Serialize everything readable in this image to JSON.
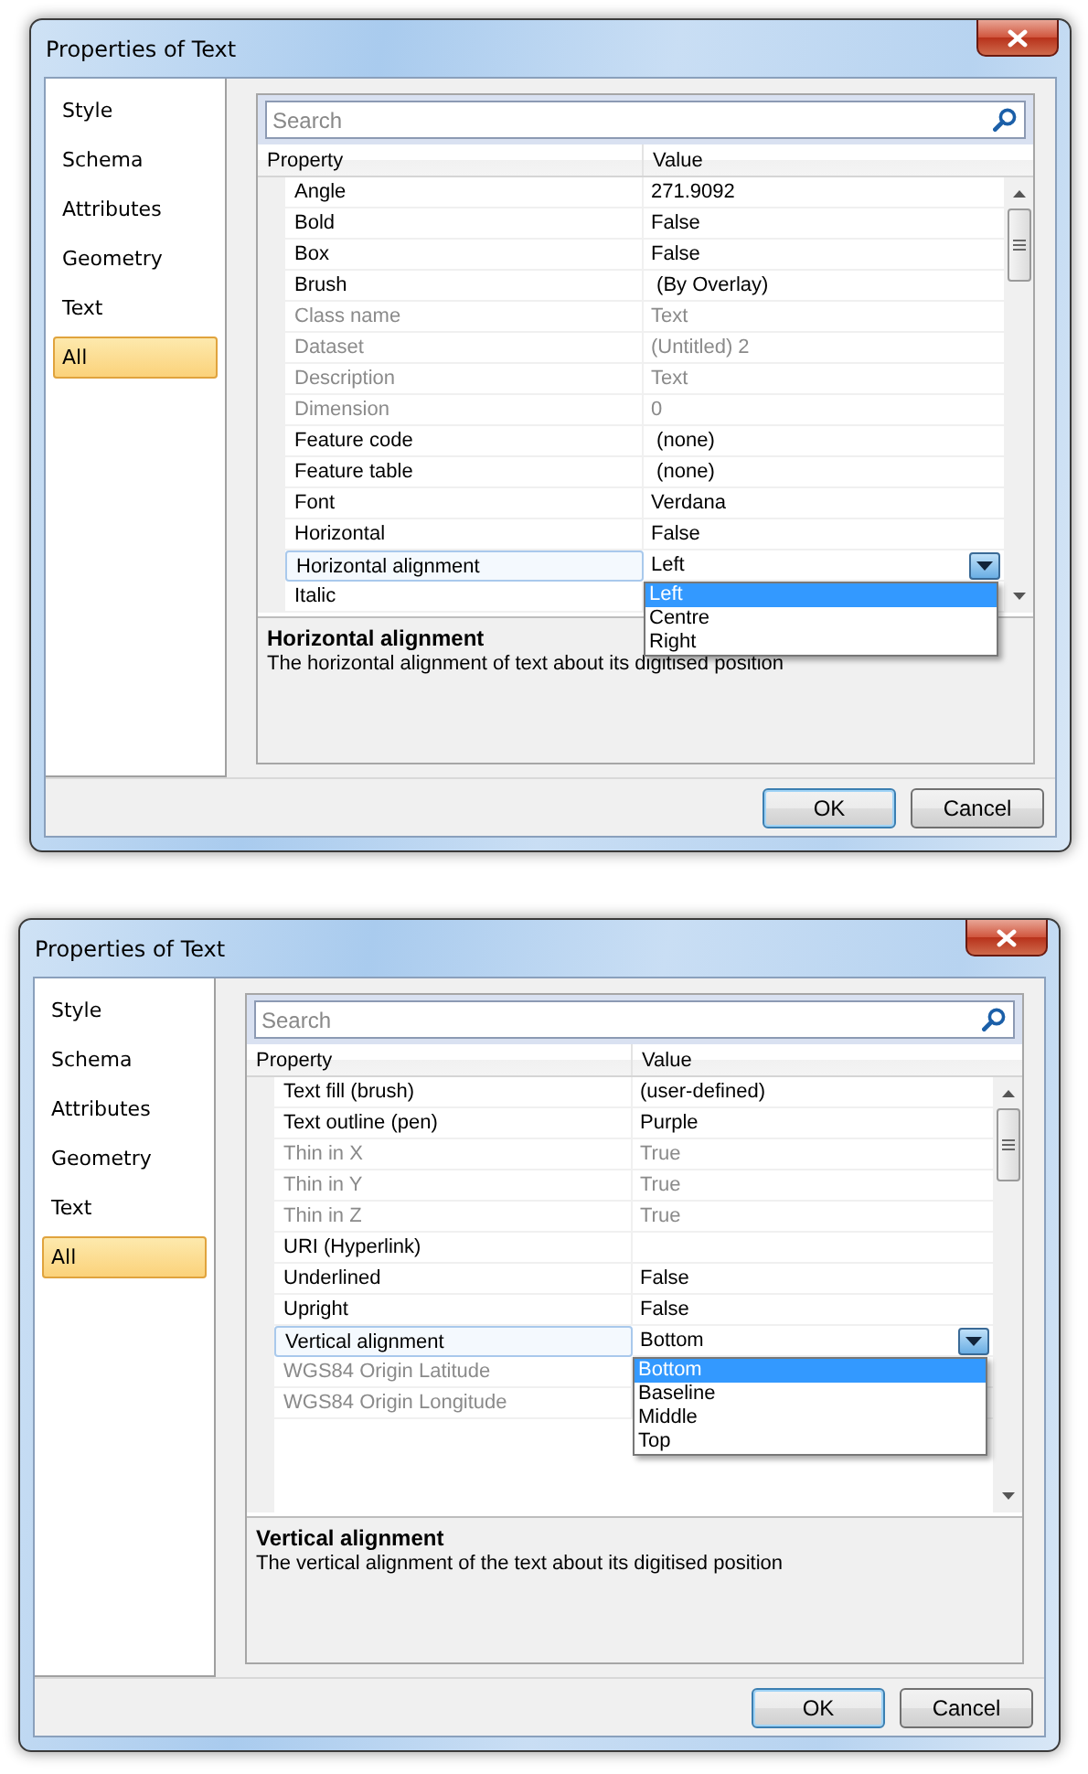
{
  "windows": [
    {
      "title": "Properties of Text",
      "nav": [
        {
          "label": "Style",
          "selected": false
        },
        {
          "label": "Schema",
          "selected": false
        },
        {
          "label": "Attributes",
          "selected": false
        },
        {
          "label": "Geometry",
          "selected": false
        },
        {
          "label": "Text",
          "selected": false
        },
        {
          "label": "All",
          "selected": true
        }
      ],
      "search": {
        "placeholder": "Search"
      },
      "grid": {
        "columns": [
          "Property",
          "Value"
        ],
        "rows": [
          {
            "property": "Angle",
            "value": "271.9092",
            "disabled": false,
            "selected": false
          },
          {
            "property": "Bold",
            "value": "False",
            "disabled": false,
            "selected": false
          },
          {
            "property": "Box",
            "value": "False",
            "disabled": false,
            "selected": false
          },
          {
            "property": "Brush",
            "value": " (By Overlay)",
            "disabled": false,
            "selected": false
          },
          {
            "property": "Class name",
            "value": "Text",
            "disabled": true,
            "selected": false
          },
          {
            "property": "Dataset",
            "value": "(Untitled) 2",
            "disabled": true,
            "selected": false
          },
          {
            "property": "Description",
            "value": "Text",
            "disabled": true,
            "selected": false
          },
          {
            "property": "Dimension",
            "value": "0",
            "disabled": true,
            "selected": false
          },
          {
            "property": "Feature code",
            "value": " (none)",
            "disabled": false,
            "selected": false
          },
          {
            "property": "Feature table",
            "value": " (none)",
            "disabled": false,
            "selected": false
          },
          {
            "property": "Font",
            "value": "Verdana",
            "disabled": false,
            "selected": false
          },
          {
            "property": "Horizontal",
            "value": "False",
            "disabled": false,
            "selected": false
          },
          {
            "property": "Horizontal alignment",
            "value": "Left",
            "disabled": false,
            "selected": true,
            "options": [
              {
                "label": "Left",
                "selected": true
              },
              {
                "label": "Centre",
                "selected": false
              },
              {
                "label": "Right",
                "selected": false
              }
            ]
          },
          {
            "property": "Italic",
            "disabled": false,
            "selected": false
          }
        ]
      },
      "description": {
        "title": "Horizontal alignment",
        "text": "The horizontal alignment of text about its digitised position"
      },
      "buttons": [
        {
          "label": "OK",
          "default": true
        },
        {
          "label": "Cancel",
          "default": false
        }
      ]
    },
    {
      "title": "Properties of Text",
      "nav": [
        {
          "label": "Style",
          "selected": false
        },
        {
          "label": "Schema",
          "selected": false
        },
        {
          "label": "Attributes",
          "selected": false
        },
        {
          "label": "Geometry",
          "selected": false
        },
        {
          "label": "Text",
          "selected": false
        },
        {
          "label": "All",
          "selected": true
        }
      ],
      "search": {
        "placeholder": "Search"
      },
      "grid": {
        "columns": [
          "Property",
          "Value"
        ],
        "rows": [
          {
            "property": "Text fill (brush)",
            "value": "(user-defined)",
            "disabled": false,
            "selected": false
          },
          {
            "property": "Text outline (pen)",
            "value": "Purple",
            "disabled": false,
            "selected": false
          },
          {
            "property": "Thin in X",
            "value": "True",
            "disabled": true,
            "selected": false
          },
          {
            "property": "Thin in Y",
            "value": "True",
            "disabled": true,
            "selected": false
          },
          {
            "property": "Thin in Z",
            "value": "True",
            "disabled": true,
            "selected": false
          },
          {
            "property": "URI (Hyperlink)",
            "disabled": false,
            "selected": false
          },
          {
            "property": "Underlined",
            "value": "False",
            "disabled": false,
            "selected": false
          },
          {
            "property": "Upright",
            "value": "False",
            "disabled": false,
            "selected": false
          },
          {
            "property": "Vertical alignment",
            "value": "Bottom",
            "disabled": false,
            "selected": true,
            "options": [
              {
                "label": "Bottom",
                "selected": true
              },
              {
                "label": "Baseline",
                "selected": false
              },
              {
                "label": "Middle",
                "selected": false
              },
              {
                "label": "Top",
                "selected": false
              }
            ]
          },
          {
            "property": "WGS84 Origin Latitude",
            "disabled": true,
            "selected": false
          },
          {
            "property": "WGS84 Origin Longitude",
            "disabled": true,
            "selected": false
          }
        ]
      },
      "description": {
        "title": "Vertical alignment",
        "text": "The vertical alignment of the text about its digitised position"
      },
      "buttons": [
        {
          "label": "OK",
          "default": true
        },
        {
          "label": "Cancel",
          "default": false
        }
      ]
    }
  ]
}
